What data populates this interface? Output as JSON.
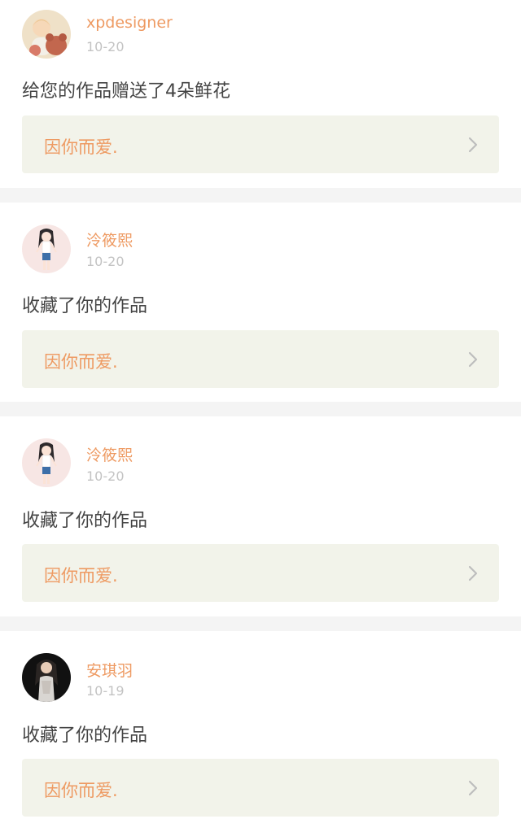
{
  "notifications": [
    {
      "username": "xpdesigner",
      "date": "10-20",
      "action": "给您的作品赠送了4朵鲜花",
      "work_title": "因你而爱.",
      "avatar_icon": "avatar-child-teddy-photo"
    },
    {
      "username": "泠筱熙",
      "date": "10-20",
      "action": "收藏了你的作品",
      "work_title": "因你而爱.",
      "avatar_icon": "avatar-anime-girl-illustration"
    },
    {
      "username": "泠筱熙",
      "date": "10-20",
      "action": "收藏了你的作品",
      "work_title": "因你而爱.",
      "avatar_icon": "avatar-anime-girl-illustration"
    },
    {
      "username": "安琪羽",
      "date": "10-19",
      "action": "收藏了你的作品",
      "work_title": "因你而爱.",
      "avatar_icon": "avatar-woman-photo"
    }
  ],
  "colors": {
    "accent": "#ee9a62",
    "date": "#c3c3c3",
    "text": "#444444",
    "work_card_bg": "#f2f3ea",
    "separator": "#f4f4f4"
  }
}
